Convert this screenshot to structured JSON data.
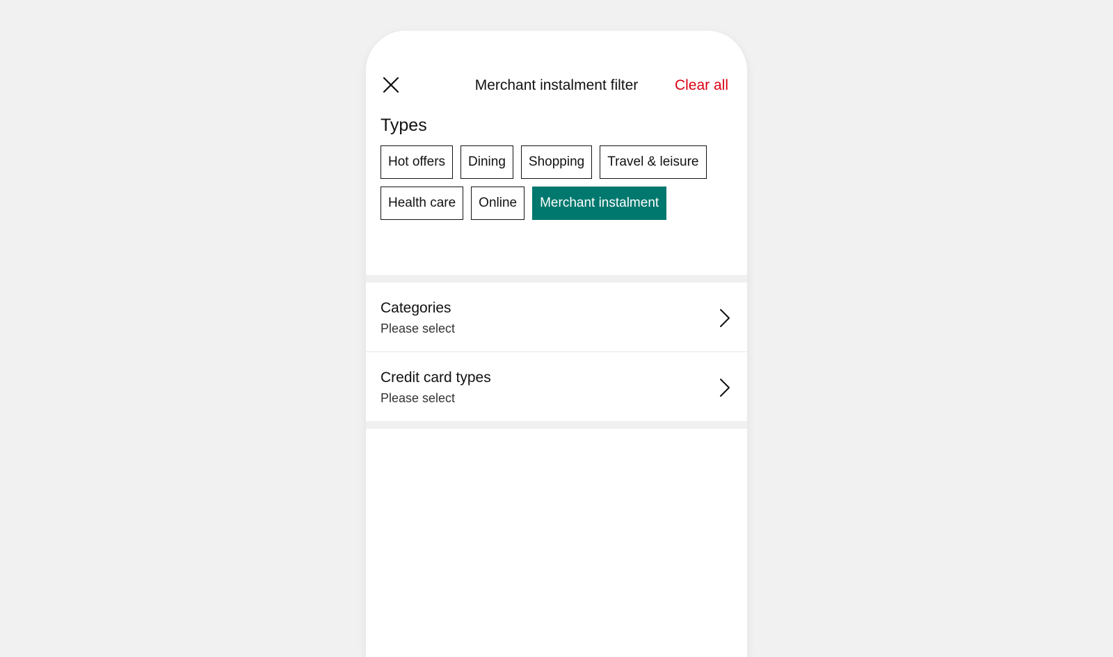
{
  "header": {
    "title": "Merchant instalment filter",
    "clear_label": "Clear all",
    "close_icon": "close-icon"
  },
  "types": {
    "heading": "Types",
    "chips": [
      {
        "label": "Hot offers",
        "selected": false
      },
      {
        "label": "Dining",
        "selected": false
      },
      {
        "label": "Shopping",
        "selected": false
      },
      {
        "label": "Travel & leisure",
        "selected": false
      },
      {
        "label": "Health care",
        "selected": false
      },
      {
        "label": "Online",
        "selected": false
      },
      {
        "label": "Merchant instalment",
        "selected": true
      }
    ]
  },
  "filters": [
    {
      "title": "Categories",
      "value": "Please select",
      "icon": "chevron-right-icon"
    },
    {
      "title": "Credit card types",
      "value": "Please select",
      "icon": "chevron-right-icon"
    }
  ],
  "colors": {
    "accent_selected": "#00786e",
    "clear_all": "#db0011",
    "background": "#f1f1f1"
  }
}
